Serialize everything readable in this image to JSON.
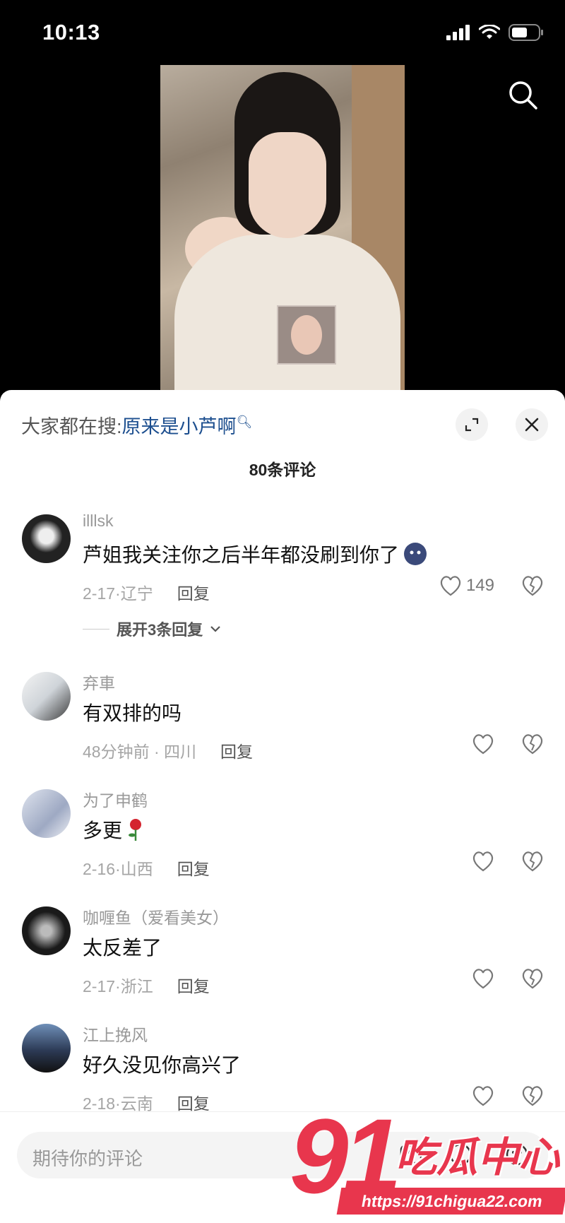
{
  "status_bar": {
    "time": "10:13"
  },
  "sheet": {
    "hot_search_prefix": "大家都在搜:",
    "hot_search_term": "原来是小芦啊",
    "comment_count": "80条评论"
  },
  "comments": [
    {
      "username": "illlsk",
      "text": "芦姐我关注你之后半年都没刷到你了",
      "time": "2-17",
      "location": "辽宁",
      "reply": "回复",
      "likes": "149",
      "expand": "展开3条回复"
    },
    {
      "username": "弃車",
      "text": "有双排的吗",
      "time": "48分钟前",
      "location": "四川",
      "reply": "回复"
    },
    {
      "username": "为了申鹤",
      "text": "多更",
      "time": "2-16",
      "location": "山西",
      "reply": "回复"
    },
    {
      "username": "咖喱鱼（爱看美女）",
      "text": "太反差了",
      "time": "2-17",
      "location": "浙江",
      "reply": "回复"
    },
    {
      "username": "江上挽风",
      "text": "好久没见你高兴了",
      "time": "2-18",
      "location": "云南",
      "reply": "回复"
    }
  ],
  "input": {
    "placeholder": "期待你的评论"
  },
  "watermark": {
    "big": "91",
    "brand": "吃瓜中心",
    "url": "https://91chigua22.com"
  },
  "icons": {
    "search": "search-icon",
    "expand": "expand-icon",
    "close": "close-icon",
    "like": "heart-icon",
    "dislike": "broken-heart-icon",
    "chevron": "chevron-down-icon"
  },
  "colors": {
    "accent": "#1d4f8f",
    "watermark": "#e8364d"
  }
}
